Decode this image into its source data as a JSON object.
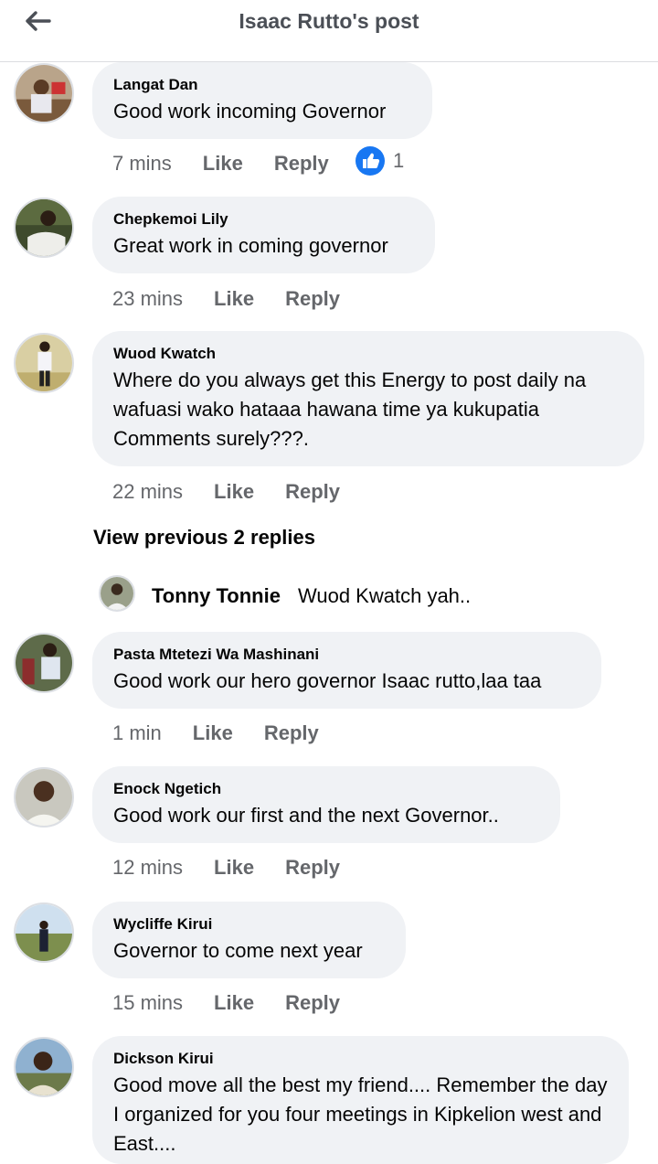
{
  "header": {
    "title": "Isaac Rutto's post"
  },
  "comments": [
    {
      "author": "Langat Dan",
      "text": "Good work incoming Governor",
      "time": "7 mins",
      "like": "Like",
      "reply": "Reply",
      "reaction_count": "1"
    },
    {
      "author": "Chepkemoi Lily",
      "text": "Great work in coming governor",
      "time": "23 mins",
      "like": "Like",
      "reply": "Reply"
    },
    {
      "author": "Wuod Kwatch",
      "text": "Where do you always get this Energy to post daily na wafuasi wako hataaa hawana time ya kukupatia Comments surely???.",
      "time": "22 mins",
      "like": "Like",
      "reply": "Reply"
    },
    {
      "author": "Pasta Mtetezi Wa Mashinani",
      "text": "Good work our hero governor Isaac rutto,laa taa",
      "time": "1 min",
      "like": "Like",
      "reply": "Reply"
    },
    {
      "author": "Enock Ngetich",
      "text": "Good work our first and the next Governor..",
      "time": "12 mins",
      "like": "Like",
      "reply": "Reply"
    },
    {
      "author": "Wycliffe Kirui",
      "text": "Governor to come next year",
      "time": "15 mins",
      "like": "Like",
      "reply": "Reply"
    },
    {
      "author": "Dickson Kirui",
      "text": "Good move all the best my friend.... Remember the day I organized for you four meetings in Kipkelion west and East...."
    }
  ],
  "view_previous": "View previous 2 replies",
  "reply_preview": {
    "author": "Tonny Tonnie",
    "text": "Wuod Kwatch yah.."
  },
  "colors": {
    "bubble": "#f0f2f5",
    "meta": "#65676b",
    "like_blue": "#1877f2"
  }
}
